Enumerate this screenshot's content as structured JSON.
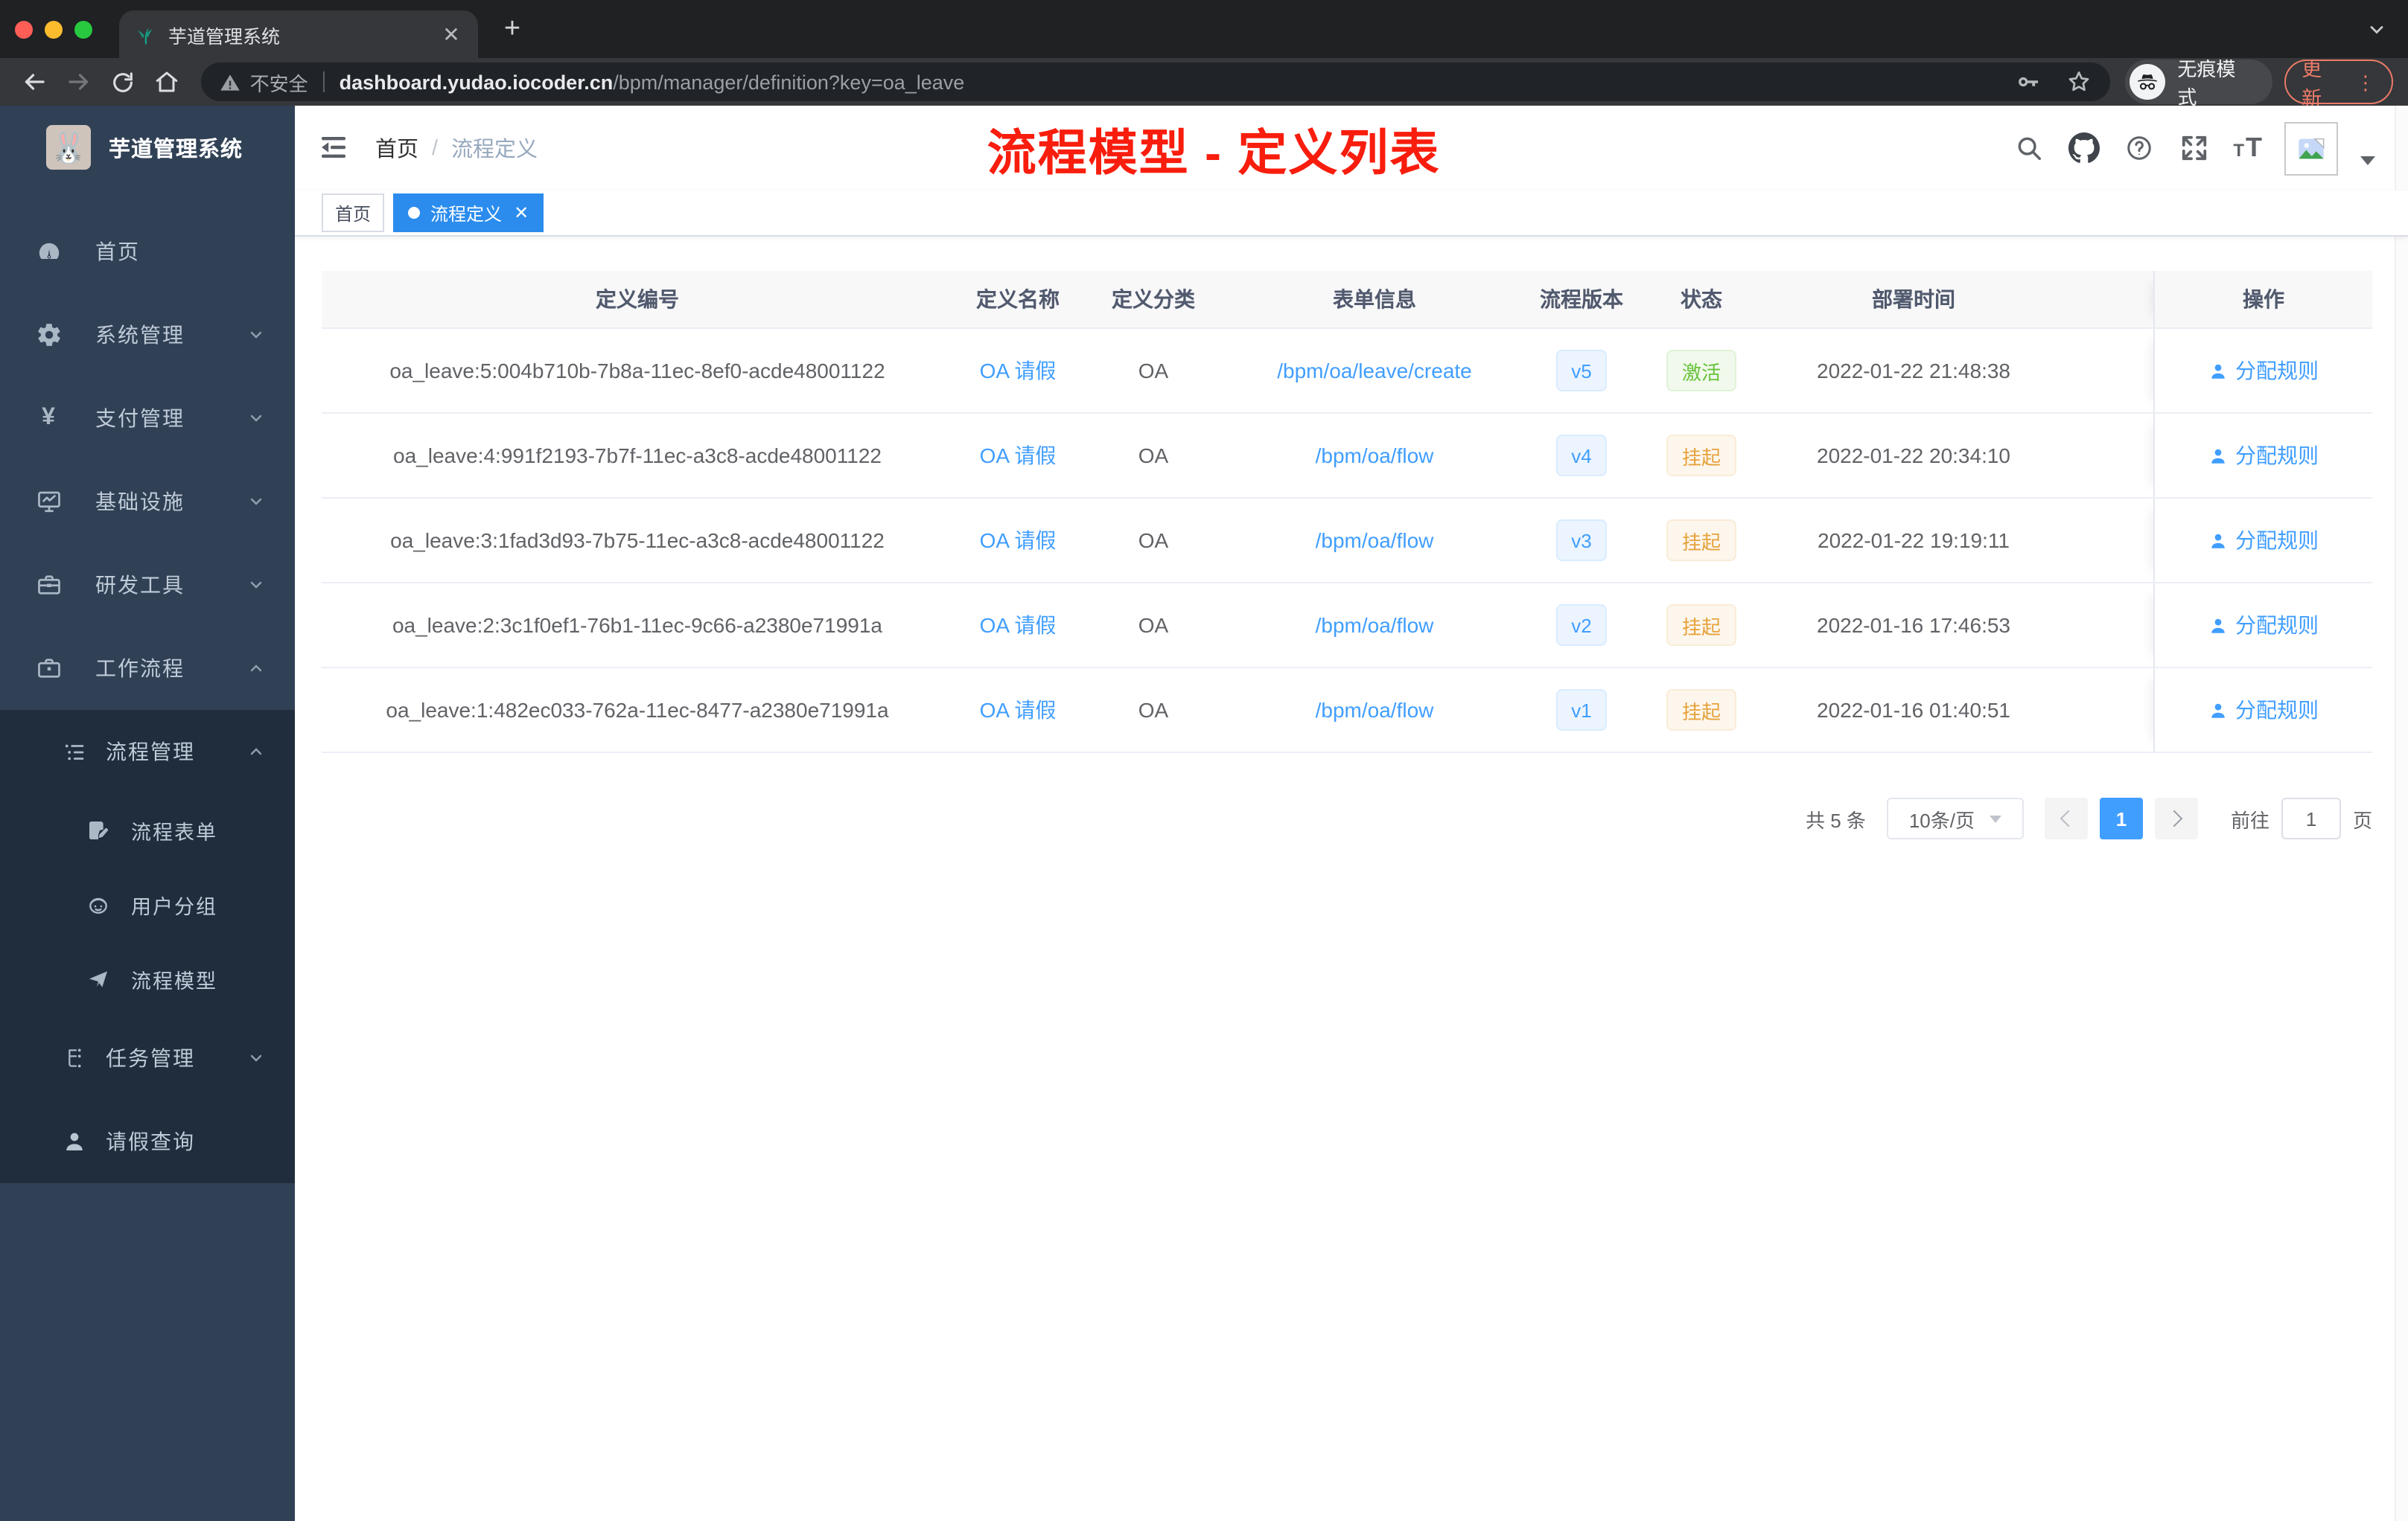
{
  "browser": {
    "tab_title": "芋道管理系统",
    "security_label": "不安全",
    "url_host": "dashboard.yudao.iocoder.cn",
    "url_path": "/bpm/manager/definition?key=oa_leave",
    "incognito_label": "无痕模式",
    "update_label": "更新"
  },
  "sidebar": {
    "title": "芋道管理系统",
    "items": [
      {
        "label": "首页"
      },
      {
        "label": "系统管理"
      },
      {
        "label": "支付管理"
      },
      {
        "label": "基础设施"
      },
      {
        "label": "研发工具"
      },
      {
        "label": "工作流程"
      },
      {
        "label": "流程管理"
      },
      {
        "label": "流程表单"
      },
      {
        "label": "用户分组"
      },
      {
        "label": "流程模型"
      },
      {
        "label": "任务管理"
      },
      {
        "label": "请假查询"
      }
    ]
  },
  "header": {
    "breadcrumb_home": "首页",
    "breadcrumb_separator": "/",
    "breadcrumb_current": "流程定义",
    "annotation": "流程模型 - 定义列表"
  },
  "tags": {
    "home": "首页",
    "active": "流程定义"
  },
  "table": {
    "columns": [
      "定义编号",
      "定义名称",
      "定义分类",
      "表单信息",
      "流程版本",
      "状态",
      "部署时间",
      "操作"
    ],
    "rows": [
      {
        "id": "oa_leave:5:004b710b-7b8a-11ec-8ef0-acde48001122",
        "name": "OA 请假",
        "category": "OA",
        "form": "/bpm/oa/leave/create",
        "version": "v5",
        "status": "激活",
        "time": "2022-01-22 21:48:38",
        "action": "分配规则"
      },
      {
        "id": "oa_leave:4:991f2193-7b7f-11ec-a3c8-acde48001122",
        "name": "OA 请假",
        "category": "OA",
        "form": "/bpm/oa/flow",
        "version": "v4",
        "status": "挂起",
        "time": "2022-01-22 20:34:10",
        "action": "分配规则"
      },
      {
        "id": "oa_leave:3:1fad3d93-7b75-11ec-a3c8-acde48001122",
        "name": "OA 请假",
        "category": "OA",
        "form": "/bpm/oa/flow",
        "version": "v3",
        "status": "挂起",
        "time": "2022-01-22 19:19:11",
        "action": "分配规则"
      },
      {
        "id": "oa_leave:2:3c1f0ef1-76b1-11ec-9c66-a2380e71991a",
        "name": "OA 请假",
        "category": "OA",
        "form": "/bpm/oa/flow",
        "version": "v2",
        "status": "挂起",
        "time": "2022-01-16 17:46:53",
        "action": "分配规则"
      },
      {
        "id": "oa_leave:1:482ec033-762a-11ec-8477-a2380e71991a",
        "name": "OA 请假",
        "category": "OA",
        "form": "/bpm/oa/flow",
        "version": "v1",
        "status": "挂起",
        "time": "2022-01-16 01:40:51",
        "action": "分配规则"
      }
    ]
  },
  "pagination": {
    "total": "共 5 条",
    "page_size": "10条/页",
    "current_page": "1",
    "goto_label": "前往",
    "goto_value": "1",
    "page_unit": "页"
  },
  "colors": {
    "accent": "#409eff",
    "active_tag": "#2b8cee",
    "success": "#67c23a",
    "warning": "#e6a23c",
    "annotation_red": "#f81d0d",
    "sidebar_bg": "#304156",
    "submenu_bg": "#1f2d3d"
  }
}
